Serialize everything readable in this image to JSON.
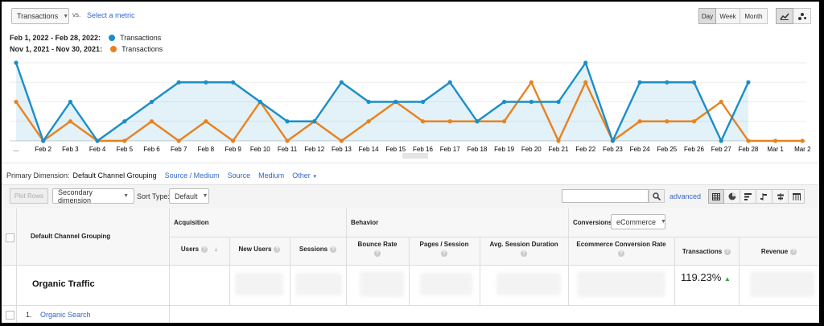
{
  "toolbar": {
    "metric_select": "Transactions",
    "vs": "vs.",
    "select_metric": "Select a metric",
    "period_buttons": [
      "Day",
      "Week",
      "Month"
    ],
    "active_period": "Day"
  },
  "legend": {
    "ranges": [
      {
        "range": "Feb 1, 2022 - Feb 28, 2022:",
        "series": "Transactions",
        "color": "#1a8ec8"
      },
      {
        "range": "Nov 1, 2021 - Nov 30, 2021:",
        "series": "Transactions",
        "color": "#e8821e"
      }
    ]
  },
  "chart_data": {
    "type": "line",
    "categories": [
      "...",
      "Feb 2",
      "Feb 3",
      "Feb 4",
      "Feb 5",
      "Feb 6",
      "Feb 7",
      "Feb 8",
      "Feb 9",
      "Feb 10",
      "Feb 11",
      "Feb 12",
      "Feb 13",
      "Feb 14",
      "Feb 15",
      "Feb 16",
      "Feb 17",
      "Feb 18",
      "Feb 19",
      "Feb 20",
      "Feb 21",
      "Feb 22",
      "Feb 23",
      "Feb 24",
      "Feb 25",
      "Feb 26",
      "Feb 27",
      "Feb 28",
      "Mar 1",
      "Mar 2"
    ],
    "series": [
      {
        "name": "Feb 1, 2022 - Feb 28, 2022: Transactions",
        "color": "#1a8ec8",
        "filled": true,
        "values": [
          4,
          0,
          2,
          0,
          1,
          2,
          3,
          3,
          3,
          2,
          1,
          1,
          3,
          2,
          2,
          2,
          3,
          1,
          2,
          2,
          2,
          4,
          0,
          3,
          3,
          3,
          0,
          3,
          null,
          null
        ]
      },
      {
        "name": "Nov 1, 2021 - Nov 30, 2021: Transactions",
        "color": "#e8821e",
        "filled": false,
        "values": [
          2,
          0,
          1,
          0,
          0,
          1,
          0,
          1,
          0,
          2,
          0,
          1,
          0,
          1,
          2,
          1,
          1,
          1,
          1,
          3,
          0,
          3,
          0,
          1,
          1,
          1,
          2,
          0,
          0,
          0
        ]
      }
    ],
    "ylim": [
      0,
      4
    ],
    "grid": true,
    "legend_position": "top-left"
  },
  "dimensions": {
    "label": "Primary Dimension:",
    "active": "Default Channel Grouping",
    "options": [
      "Source / Medium",
      "Source",
      "Medium",
      "Other"
    ]
  },
  "controls": {
    "plot_rows": "Plot Rows",
    "secondary_dimension": "Secondary dimension",
    "sort_type_label": "Sort Type:",
    "sort_type_value": "Default",
    "search_placeholder": "",
    "advanced": "advanced"
  },
  "table": {
    "dimension_header": "Default Channel Grouping",
    "groups": {
      "acquisition": "Acquisition",
      "behavior": "Behavior",
      "conversions": "Conversions",
      "conversions_select": "eCommerce"
    },
    "columns": [
      "Users",
      "New Users",
      "Sessions",
      "Bounce Rate",
      "Pages / Session",
      "Avg. Session Duration",
      "Ecommerce Conversion Rate",
      "Transactions",
      "Revenue"
    ],
    "summary_row": {
      "label": "Organic Traffic",
      "transactions_change": "119.23%"
    },
    "rows": [
      {
        "index": "1.",
        "label": "Organic Search"
      }
    ]
  }
}
